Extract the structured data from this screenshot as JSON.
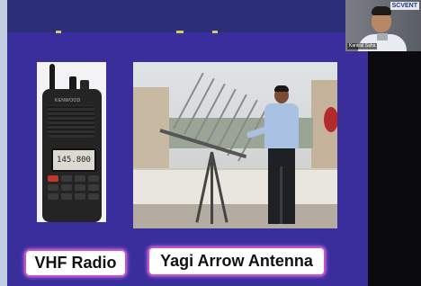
{
  "slide": {
    "background": "#3a2e9c",
    "captions": {
      "vhf_radio": "VHF Radio",
      "yagi_antenna": "Yagi Arrow Antenna"
    }
  },
  "radio": {
    "brand_text": "KENWOOD",
    "lcd_frequency": "145.800"
  },
  "video_tile": {
    "logo": "SCVENT",
    "participant_name": "Kantilal Saha"
  }
}
